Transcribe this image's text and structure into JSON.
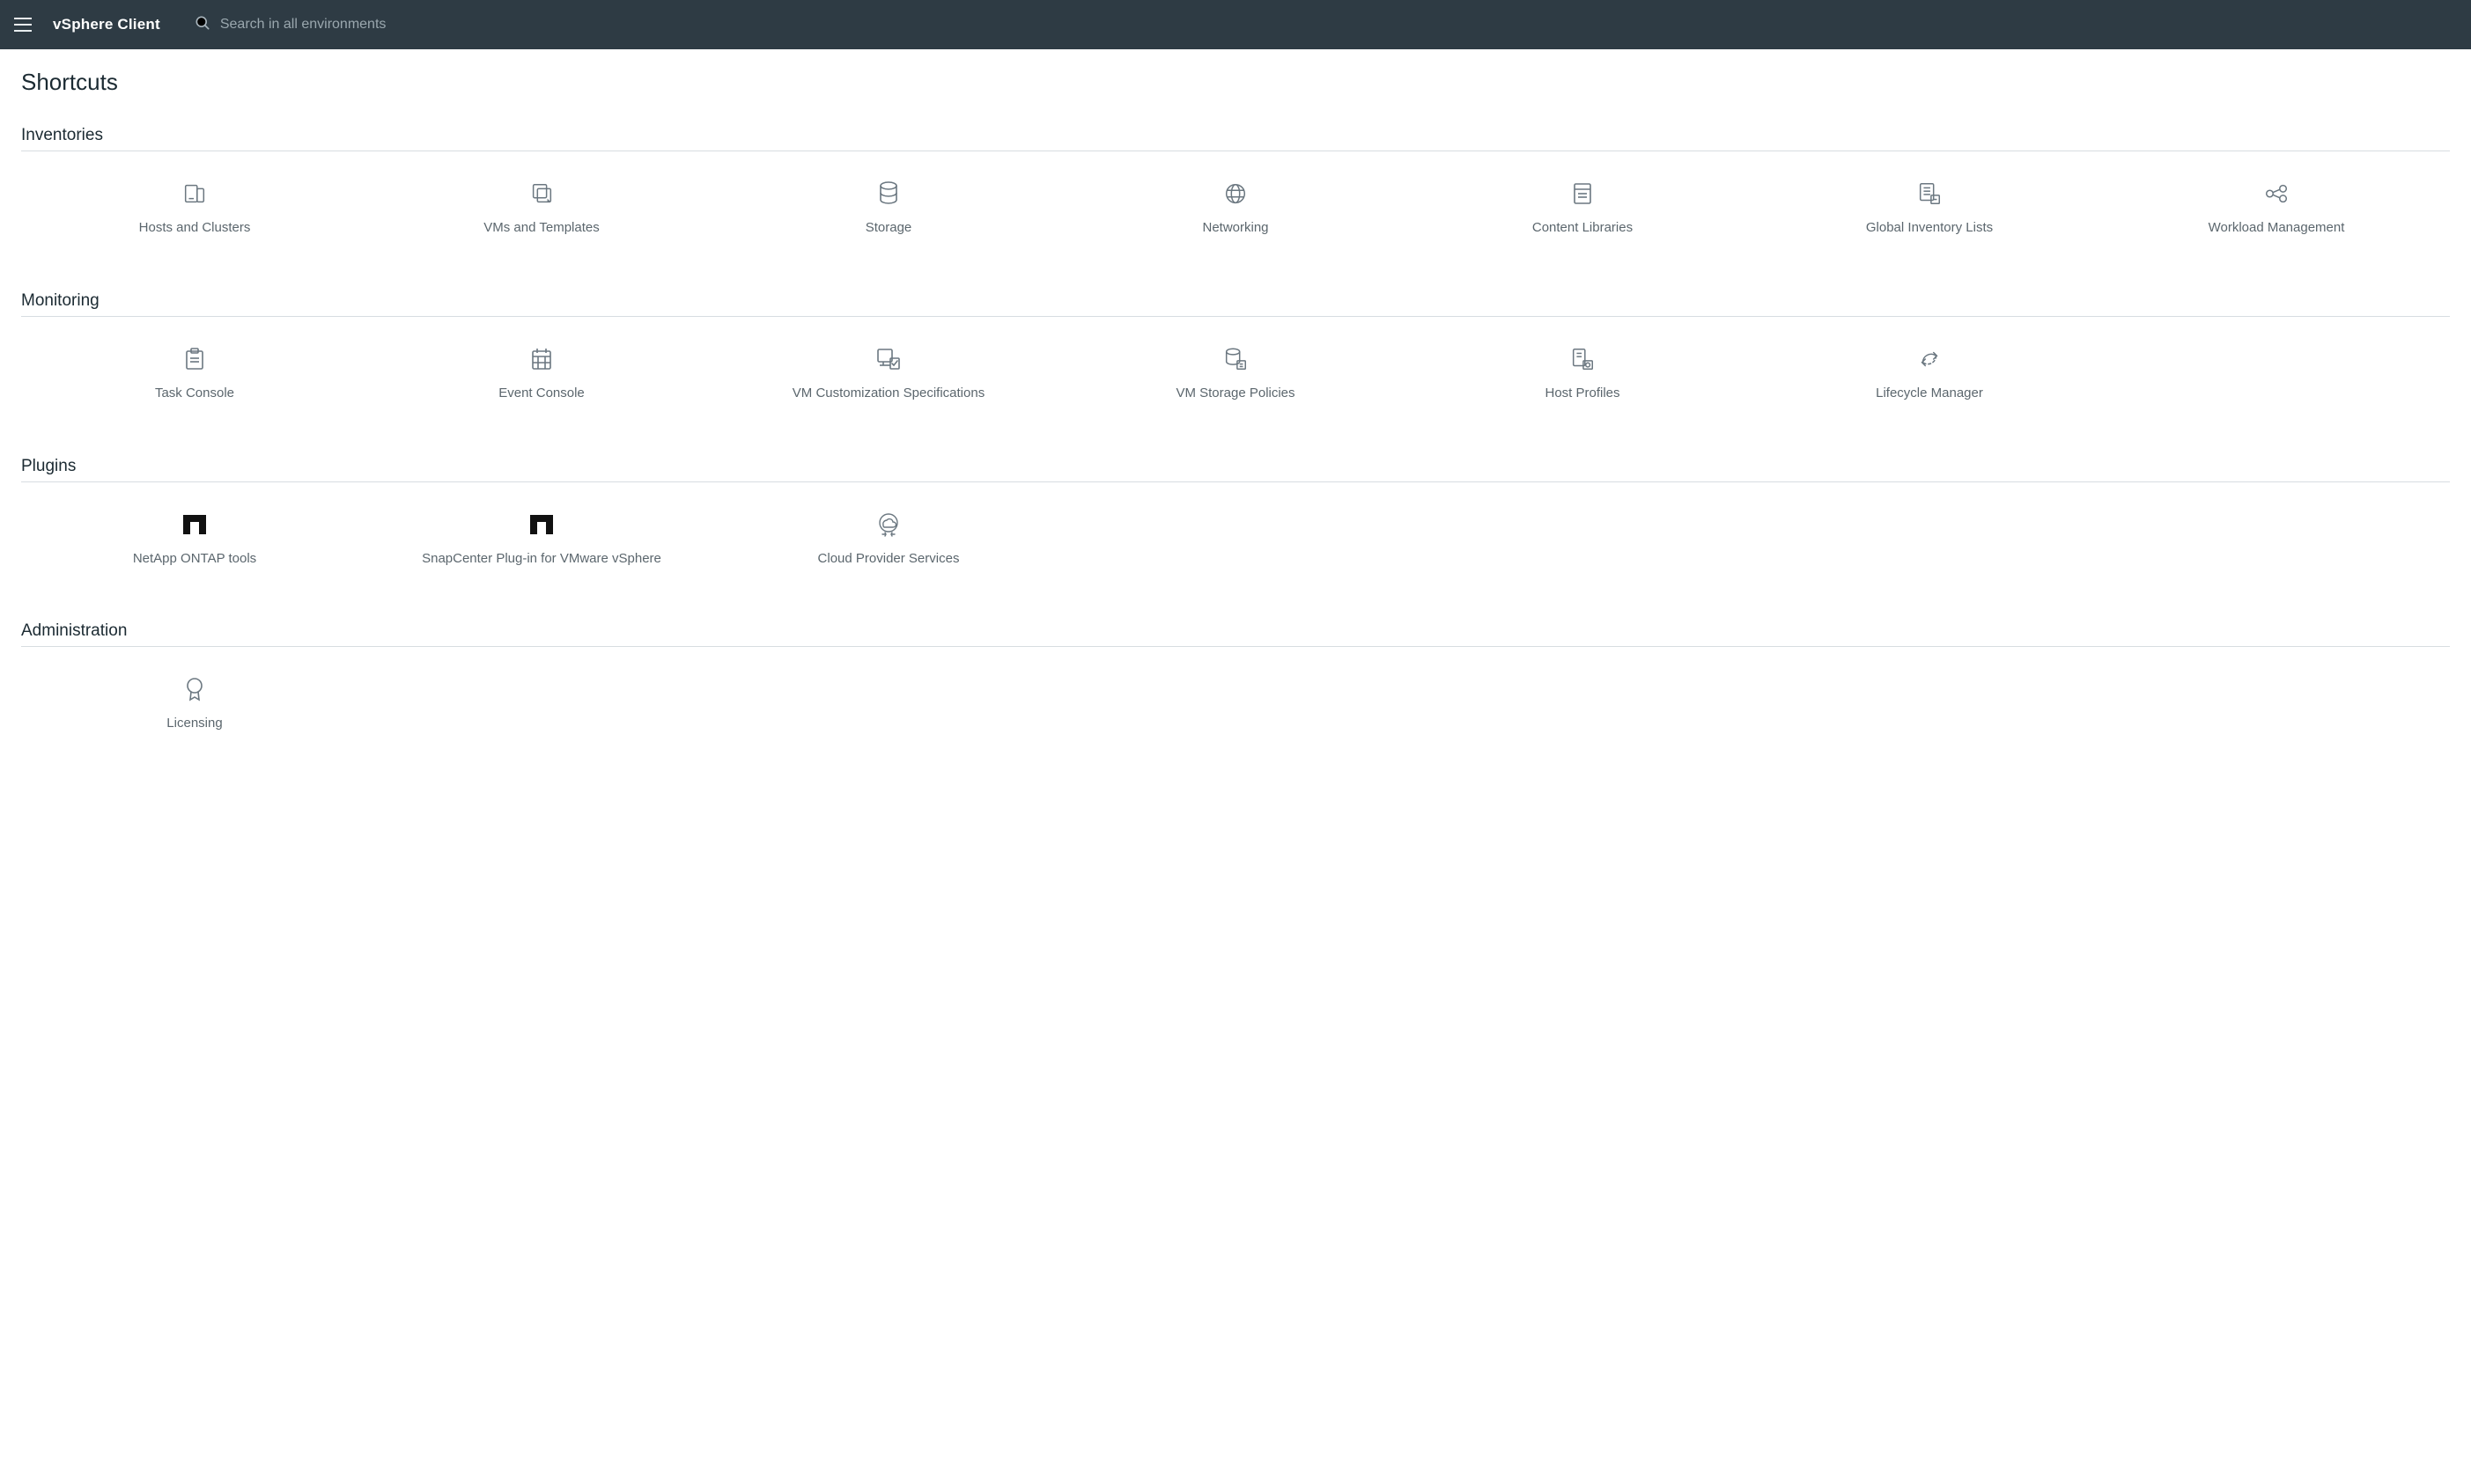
{
  "header": {
    "app_title": "vSphere Client",
    "search_placeholder": "Search in all environments"
  },
  "page_title": "Shortcuts",
  "sections": {
    "inventories": {
      "title": "Inventories",
      "items": [
        {
          "label": "Hosts and Clusters"
        },
        {
          "label": "VMs and Templates"
        },
        {
          "label": "Storage"
        },
        {
          "label": "Networking"
        },
        {
          "label": "Content Libraries"
        },
        {
          "label": "Global Inventory Lists"
        },
        {
          "label": "Workload Management"
        }
      ]
    },
    "monitoring": {
      "title": "Monitoring",
      "items": [
        {
          "label": "Task Console"
        },
        {
          "label": "Event Console"
        },
        {
          "label": "VM Customization Specifications"
        },
        {
          "label": "VM Storage Policies"
        },
        {
          "label": "Host Profiles"
        },
        {
          "label": "Lifecycle Manager"
        }
      ]
    },
    "plugins": {
      "title": "Plugins",
      "items": [
        {
          "label": "NetApp ONTAP tools"
        },
        {
          "label": "SnapCenter Plug-in for VMware vSphere"
        },
        {
          "label": "Cloud Provider Services"
        }
      ]
    },
    "administration": {
      "title": "Administration",
      "items": [
        {
          "label": "Licensing"
        }
      ]
    }
  }
}
